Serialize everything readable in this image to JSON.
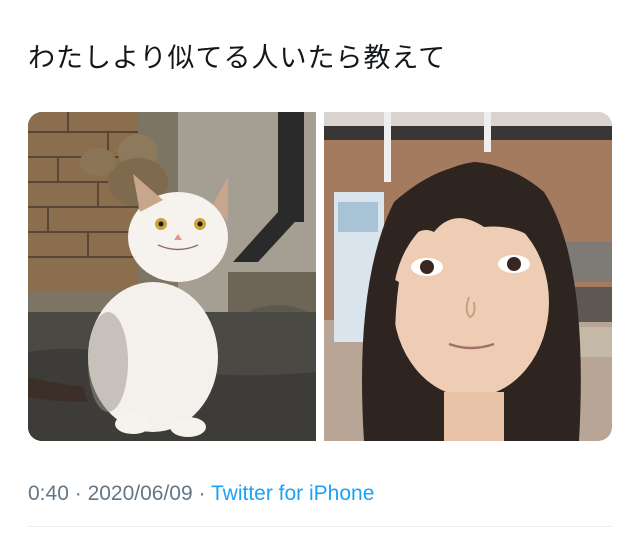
{
  "tweet": {
    "text": "わたしより似てる人いたら教えて",
    "media": [
      {
        "label": "cat photo"
      },
      {
        "label": "person photo"
      }
    ],
    "meta": {
      "time": "0:40",
      "separator": "·",
      "date": "2020/06/09",
      "source": "Twitter for iPhone"
    }
  }
}
